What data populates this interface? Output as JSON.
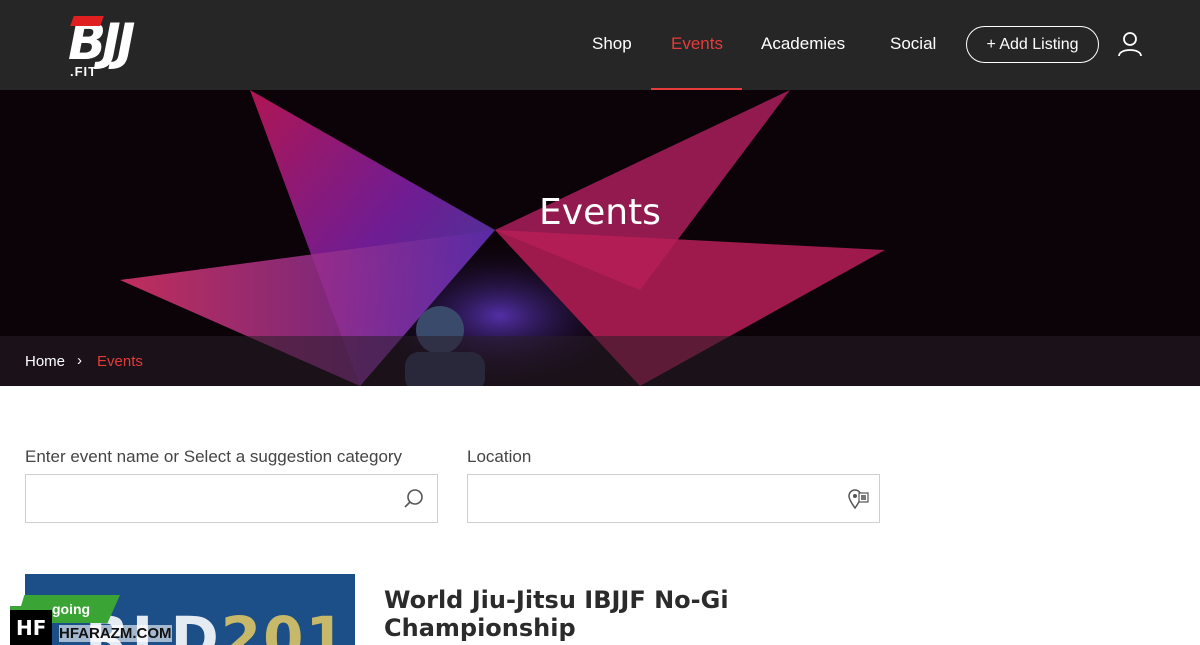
{
  "logo": {
    "main": "BJJ",
    "suffix": ".FIT"
  },
  "nav": {
    "items": [
      {
        "label": "Shop",
        "active": false
      },
      {
        "label": "Events",
        "active": true
      },
      {
        "label": "Academies",
        "active": false
      },
      {
        "label": "Social",
        "active": false
      }
    ],
    "add_listing_label": "+ Add Listing",
    "user_icon": "user-icon"
  },
  "hero": {
    "title": "Events"
  },
  "breadcrumb": {
    "home": "Home",
    "separator": "›",
    "current": "Events"
  },
  "search": {
    "event_label": "Enter event name or Select a suggestion category",
    "event_value": "",
    "location_label": "Location",
    "location_value": "",
    "search_icon": "search-icon",
    "location_icon": "location-pin-icon"
  },
  "events": [
    {
      "badge": "going",
      "title": "World Jiu-Jitsu IBJJF No-Gi Championship"
    }
  ],
  "watermark": {
    "logo": "HF",
    "text": "HFARAZM.COM"
  },
  "colors": {
    "header_bg": "#262626",
    "accent": "#e63b3b",
    "badge_green": "#3aa435"
  }
}
